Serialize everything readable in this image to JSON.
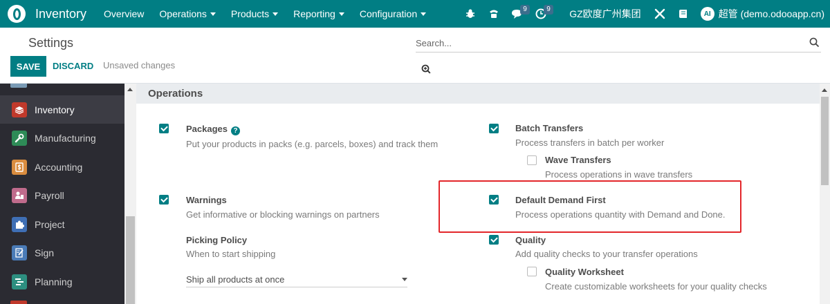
{
  "navbar": {
    "app_name": "Inventory",
    "menus": [
      "Overview",
      "Operations",
      "Products",
      "Reporting",
      "Configuration"
    ],
    "chat_count": "9",
    "activity_count": "9",
    "company": "GZ欧度广州集团",
    "avatar_initials": "AI",
    "user": "超管 (demo.odooapp.cn)",
    "color": "#017e84"
  },
  "control_panel": {
    "breadcrumb": "Settings",
    "save_label": "SAVE",
    "discard_label": "DISCARD",
    "status": "Unsaved changes",
    "search_placeholder": "Search..."
  },
  "sidebar": {
    "items": [
      {
        "label": "Inventory",
        "icon": "inventory-icon",
        "color": "#c0392b",
        "active": true
      },
      {
        "label": "Manufacturing",
        "icon": "wrench-icon",
        "color": "#2e8b57"
      },
      {
        "label": "Accounting",
        "icon": "dollar-icon",
        "color": "#d98c3f"
      },
      {
        "label": "Payroll",
        "icon": "payroll-icon",
        "color": "#c06b8c"
      },
      {
        "label": "Project",
        "icon": "puzzle-icon",
        "color": "#3f6fb5"
      },
      {
        "label": "Sign",
        "icon": "sign-icon",
        "color": "#4a7bb7"
      },
      {
        "label": "Planning",
        "icon": "planning-icon",
        "color": "#2d8f80"
      }
    ]
  },
  "section": {
    "title": "Operations"
  },
  "settings": {
    "packages": {
      "title": "Packages",
      "desc": "Put your products in packs (e.g. parcels, boxes) and track them",
      "checked": true
    },
    "batch": {
      "title": "Batch Transfers",
      "desc": "Process transfers in batch per worker",
      "checked": true
    },
    "wave": {
      "title": "Wave Transfers",
      "desc": "Process operations in wave transfers",
      "checked": false
    },
    "warnings": {
      "title": "Warnings",
      "desc": "Get informative or blocking warnings on partners",
      "checked": true
    },
    "demand": {
      "title": "Default Demand First",
      "desc": "Process operations quantity with Demand and Done.",
      "checked": true
    },
    "picking": {
      "title": "Picking Policy",
      "desc": "When to start shipping",
      "value": "Ship all products at once"
    },
    "quality": {
      "title": "Quality",
      "desc": "Add quality checks to your transfer operations",
      "checked": true
    },
    "worksheet": {
      "title": "Quality Worksheet",
      "desc": "Create customizable worksheets for your quality checks",
      "checked": false
    }
  },
  "highlight_color": "#e3262a"
}
